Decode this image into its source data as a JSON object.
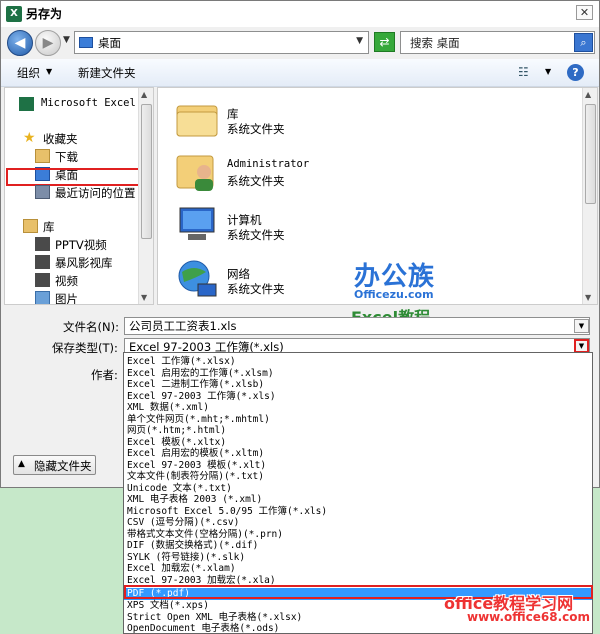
{
  "window": {
    "title": "另存为",
    "app_icon": "X",
    "close_glyph": "✕"
  },
  "nav": {
    "back_glyph": "◀",
    "forward_glyph": "▶",
    "address": "桌面",
    "search_placeholder": "搜索 桌面"
  },
  "toolbar": {
    "organize": "组织",
    "new_folder": "新建文件夹"
  },
  "sidebar": {
    "items": [
      {
        "label": "Microsoft Excel",
        "icon": "excel-icon"
      },
      {
        "label": "收藏夹",
        "icon": "star-icon"
      },
      {
        "label": "下载",
        "icon": "download-folder-icon"
      },
      {
        "label": "桌面",
        "icon": "desktop-icon"
      },
      {
        "label": "最近访问的位置",
        "icon": "recent-places-icon"
      },
      {
        "label": "库",
        "icon": "library-icon"
      },
      {
        "label": "PPTV视频",
        "icon": "video-library-icon"
      },
      {
        "label": "暴风影视库",
        "icon": "video-library-icon"
      },
      {
        "label": "视频",
        "icon": "video-library-icon"
      },
      {
        "label": "图片",
        "icon": "pictures-library-icon"
      }
    ]
  },
  "content": {
    "items": [
      {
        "name": "库",
        "type": "系统文件夹",
        "icon": "library-folder-icon"
      },
      {
        "name": "Administrator",
        "type": "系统文件夹",
        "icon": "user-folder-icon"
      },
      {
        "name": "计算机",
        "type": "系统文件夹",
        "icon": "computer-icon"
      },
      {
        "name": "网络",
        "type": "系统文件夹",
        "icon": "network-icon"
      }
    ]
  },
  "form": {
    "filename_label": "文件名(N):",
    "filename_value": "公司员工工资表1.xls",
    "savetype_label": "保存类型(T):",
    "savetype_value": "Excel 97-2003 工作簿(*.xls)",
    "author_label": "作者:",
    "hide_folders": "隐藏文件夹"
  },
  "dropdown": {
    "options": [
      "Excel 工作簿(*.xlsx)",
      "Excel 启用宏的工作簿(*.xlsm)",
      "Excel 二进制工作簿(*.xlsb)",
      "Excel 97-2003 工作簿(*.xls)",
      "XML 数据(*.xml)",
      "单个文件网页(*.mht;*.mhtml)",
      "网页(*.htm;*.html)",
      "Excel 模板(*.xltx)",
      "Excel 启用宏的模板(*.xltm)",
      "Excel 97-2003 模板(*.xlt)",
      "文本文件(制表符分隔)(*.txt)",
      "Unicode 文本(*.txt)",
      "XML 电子表格 2003 (*.xml)",
      "Microsoft Excel 5.0/95 工作簿(*.xls)",
      "CSV (逗号分隔)(*.csv)",
      "带格式文本文件(空格分隔)(*.prn)",
      "DIF (数据交换格式)(*.dif)",
      "SYLK (符号链接)(*.slk)",
      "Excel 加载宏(*.xlam)",
      "Excel 97-2003 加载宏(*.xla)",
      "PDF (*.pdf)",
      "XPS 文档(*.xps)",
      "Strict Open XML 电子表格(*.xlsx)",
      "OpenDocument 电子表格(*.ods)"
    ],
    "selected_index": 20
  },
  "watermarks": {
    "logo": "办公族",
    "url": "Officezu.com",
    "tagline": "Excel教程",
    "footer_site": "office教程学习网",
    "footer_url": "www.office68.com"
  },
  "colors": {
    "highlight_red": "#e02020",
    "selection_blue": "#3399ff",
    "background_green": "#c6e8c9"
  }
}
